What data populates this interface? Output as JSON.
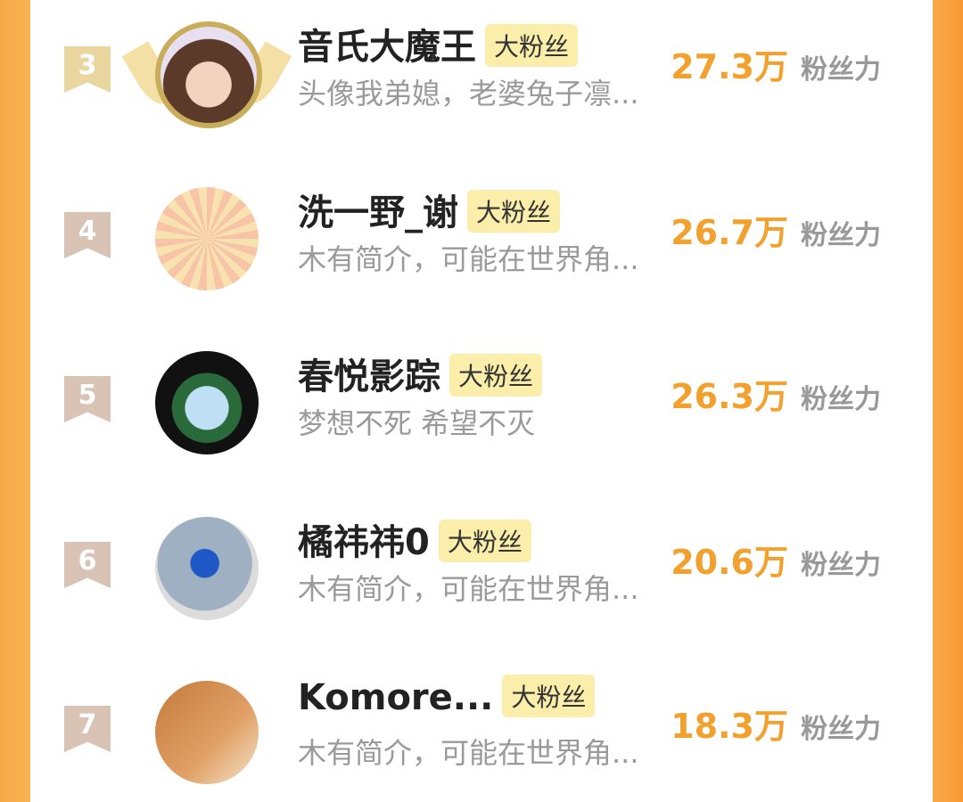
{
  "rows": [
    {
      "rank": "3",
      "name": "音氏大魔王",
      "badge": "大粉丝",
      "desc": "头像我弟媳，老婆兔子凛...",
      "score": "27.3万",
      "unit": "粉丝力"
    },
    {
      "rank": "4",
      "name": "洗一野_谢",
      "badge": "大粉丝",
      "desc": "木有简介，可能在世界角...",
      "score": "26.7万",
      "unit": "粉丝力"
    },
    {
      "rank": "5",
      "name": "春悦影踪",
      "badge": "大粉丝",
      "desc": "梦想不死 希望不灭",
      "score": "26.3万",
      "unit": "粉丝力"
    },
    {
      "rank": "6",
      "name": "橘祎祎0",
      "badge": "大粉丝",
      "desc": "木有简介，可能在世界角...",
      "score": "20.6万",
      "unit": "粉丝力"
    },
    {
      "rank": "7",
      "name": "Komore...",
      "badge": "大粉丝",
      "desc": "木有简介，可能在世界角...",
      "score": "18.3万",
      "unit": "粉丝力"
    }
  ],
  "colors": {
    "accent": "#f2a12e",
    "badge_bg": "#fbeeaa",
    "rank_bg": "#d8c3b5"
  }
}
